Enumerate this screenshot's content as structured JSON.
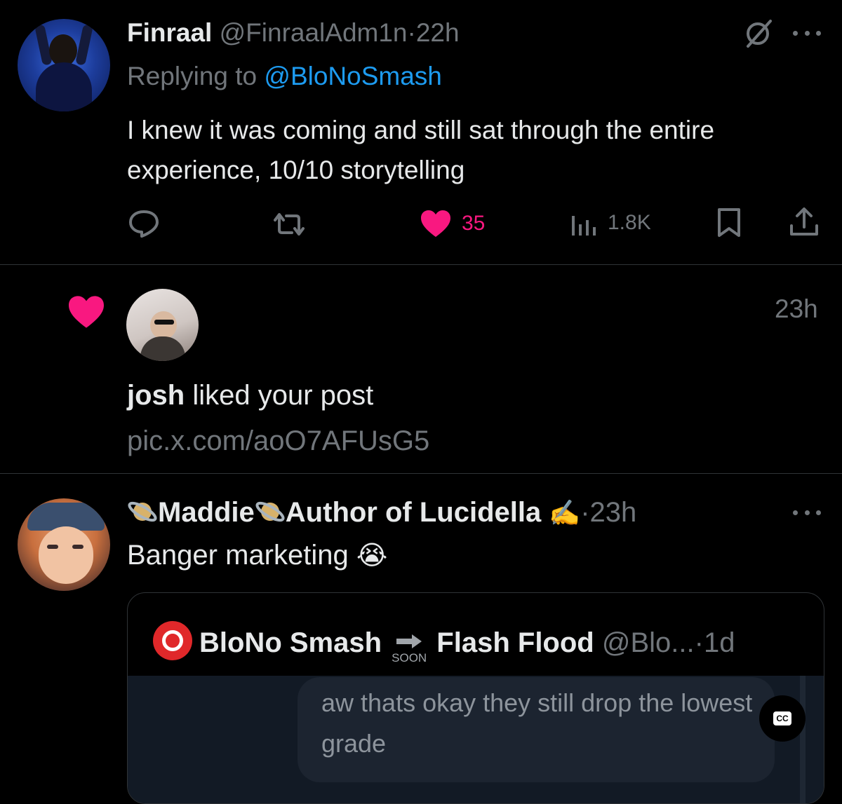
{
  "tweet1": {
    "display_name": "Finraal",
    "handle": "@FinraalAdm1n",
    "separator": "·",
    "time": "22h",
    "replying_prefix": "Replying to ",
    "replying_handle": "@BloNoSmash",
    "text": "I knew it was coming and still sat through the entire experience, 10/10 storytelling",
    "actions": {
      "likes": "35",
      "views": "1.8K"
    },
    "like_color": "#f91880",
    "link_color": "#1d9bf0"
  },
  "notification": {
    "time": "23h",
    "user": "josh",
    "action_text": " liked your post",
    "link": "pic.x.com/aoO7AFUsG5"
  },
  "tweet2": {
    "display_name_part1": "Maddie",
    "display_name_part2": "Author of Lucidella",
    "writing_emoji": "✍️",
    "separator": "·",
    "time": "23h",
    "text": "Banger marketing",
    "emoji": "😭",
    "quote": {
      "display_name_part1": "BloNo Smash",
      "soon_label": "SOON",
      "display_name_part2": "Flash Flood",
      "handle": "@Blo...",
      "separator": "·",
      "time": "1d",
      "media_text": "aw thats okay they still drop the lowest grade",
      "cc_label": "CC"
    }
  }
}
